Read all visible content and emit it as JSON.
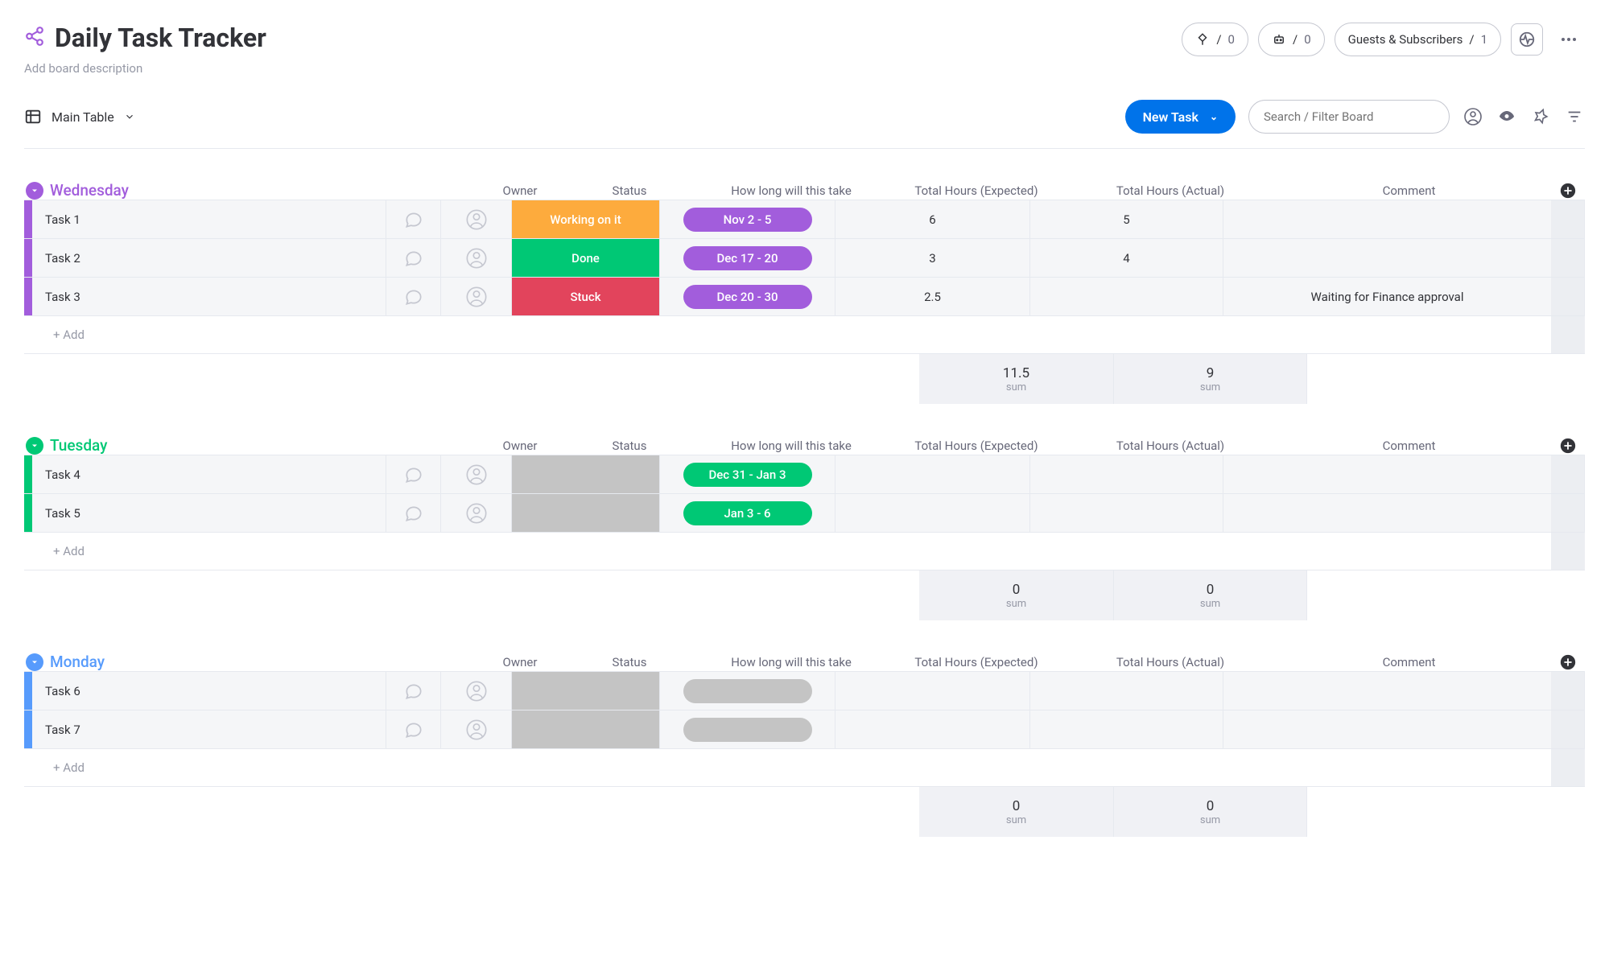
{
  "header": {
    "title": "Daily Task Tracker",
    "subtitle": "Add board description",
    "integrations_count": "0",
    "automations_count": "0",
    "guests_label": "Guests & Subscribers",
    "guests_count": "1"
  },
  "toolbar": {
    "view_label": "Main Table",
    "new_task_label": "New Task",
    "search_placeholder": "Search / Filter Board"
  },
  "columns": {
    "owner": "Owner",
    "status": "Status",
    "time": "How long will this take",
    "expected": "Total Hours (Expected)",
    "actual": "Total Hours (Actual)",
    "comment": "Comment"
  },
  "add_row_label": "+ Add",
  "sum_label": "sum",
  "groups": [
    {
      "name": "Wednesday",
      "color": "#a25ddc",
      "stripe": "#a25ddc",
      "stripe_light": "#c9a6ec",
      "sum_expected": "11.5",
      "sum_actual": "9",
      "rows": [
        {
          "task": "Task 1",
          "status": "Working on it",
          "status_color": "#fdab3d",
          "time": "Nov 2 - 5",
          "time_color": "#a25ddc",
          "expected": "6",
          "actual": "5",
          "comment": ""
        },
        {
          "task": "Task 2",
          "status": "Done",
          "status_color": "#00c875",
          "time": "Dec 17 - 20",
          "time_color": "#a25ddc",
          "expected": "3",
          "actual": "4",
          "comment": ""
        },
        {
          "task": "Task 3",
          "status": "Stuck",
          "status_color": "#e2445c",
          "time": "Dec 20 - 30",
          "time_color": "#a25ddc",
          "expected": "2.5",
          "actual": "",
          "comment": "Waiting for Finance approval"
        }
      ]
    },
    {
      "name": "Tuesday",
      "color": "#00c875",
      "stripe": "#00c875",
      "stripe_light": "#8fe8c4",
      "sum_expected": "0",
      "sum_actual": "0",
      "rows": [
        {
          "task": "Task 4",
          "status": "",
          "status_color": "#c4c4c4",
          "time": "Dec 31 - Jan 3",
          "time_color": "#00c875",
          "expected": "",
          "actual": "",
          "comment": ""
        },
        {
          "task": "Task 5",
          "status": "",
          "status_color": "#c4c4c4",
          "time": "Jan 3 - 6",
          "time_color": "#00c875",
          "expected": "",
          "actual": "",
          "comment": ""
        }
      ]
    },
    {
      "name": "Monday",
      "color": "#579bfc",
      "stripe": "#579bfc",
      "stripe_light": "#aed0ff",
      "sum_expected": "0",
      "sum_actual": "0",
      "rows": [
        {
          "task": "Task 6",
          "status": "",
          "status_color": "#c4c4c4",
          "time": "-",
          "time_color": "#c4c4c4",
          "expected": "",
          "actual": "",
          "comment": ""
        },
        {
          "task": "Task 7",
          "status": "",
          "status_color": "#c4c4c4",
          "time": "-",
          "time_color": "#c4c4c4",
          "expected": "",
          "actual": "",
          "comment": ""
        }
      ]
    }
  ]
}
